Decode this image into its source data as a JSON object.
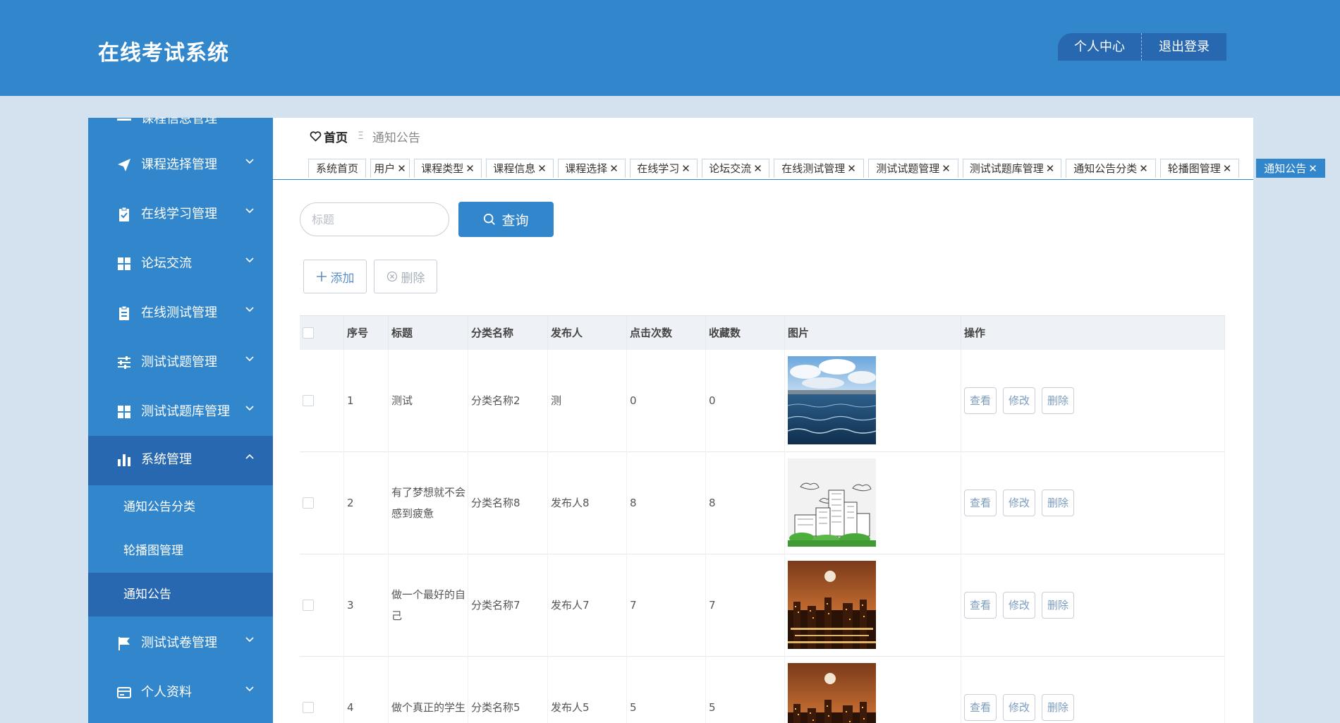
{
  "header": {
    "title": "在线考试系统",
    "profile_label": "个人中心",
    "logout_label": "退出登录"
  },
  "sidebar": {
    "partial_top_label": "课程信息管理",
    "items": [
      {
        "label": "课程选择管理",
        "icon": "send-icon"
      },
      {
        "label": "在线学习管理",
        "icon": "clipboard-check-icon"
      },
      {
        "label": "论坛交流",
        "icon": "grid-icon"
      },
      {
        "label": "在线测试管理",
        "icon": "clipboard-icon"
      },
      {
        "label": "测试试题管理",
        "icon": "sliders-icon"
      },
      {
        "label": "测试试题库管理",
        "icon": "grid-icon"
      },
      {
        "label": "系统管理",
        "icon": "bar-chart-icon"
      },
      {
        "label": "测试试卷管理",
        "icon": "flag-icon"
      },
      {
        "label": "个人资料",
        "icon": "card-icon"
      }
    ],
    "sub_items": [
      "通知公告分类",
      "轮播图管理",
      "通知公告"
    ]
  },
  "breadcrumb": {
    "home": "首页",
    "separator": "Ξ",
    "current": "通知公告"
  },
  "tabs": [
    "系统首页",
    "用户",
    "课程类型",
    "课程信息",
    "课程选择",
    "在线学习",
    "论坛交流",
    "在线测试管理",
    "测试试题管理",
    "测试试题库管理",
    "通知公告分类",
    "轮播图管理",
    "通知公告"
  ],
  "tab_close_glyph": "✕",
  "search": {
    "placeholder": "标题",
    "button_label": "查询"
  },
  "actions": {
    "add_label": "添加",
    "delete_label": "删除"
  },
  "table": {
    "columns": [
      "序号",
      "标题",
      "分类名称",
      "发布人",
      "点击次数",
      "收藏数",
      "图片",
      "操作"
    ],
    "rows": [
      {
        "no": "1",
        "title": "测试",
        "category": "分类名称2",
        "publisher": "测",
        "clicks": "0",
        "favorites": "0",
        "image": "ocean-sky"
      },
      {
        "no": "2",
        "title": "有了梦想就不会感到疲惫",
        "category": "分类名称8",
        "publisher": "发布人8",
        "clicks": "8",
        "favorites": "8",
        "image": "city-sketch"
      },
      {
        "no": "3",
        "title": "做一个最好的自己",
        "category": "分类名称7",
        "publisher": "发布人7",
        "clicks": "7",
        "favorites": "7",
        "image": "city-night"
      },
      {
        "no": "4",
        "title": "做个真正的学生",
        "category": "分类名称5",
        "publisher": "发布人5",
        "clicks": "5",
        "favorites": "5",
        "image": "city-night"
      }
    ],
    "row_actions": [
      "查看",
      "修改",
      "删除"
    ]
  },
  "colors": {
    "primary": "#3286cc",
    "primary_dark": "#2868b0",
    "background": "#d4e2f0"
  }
}
